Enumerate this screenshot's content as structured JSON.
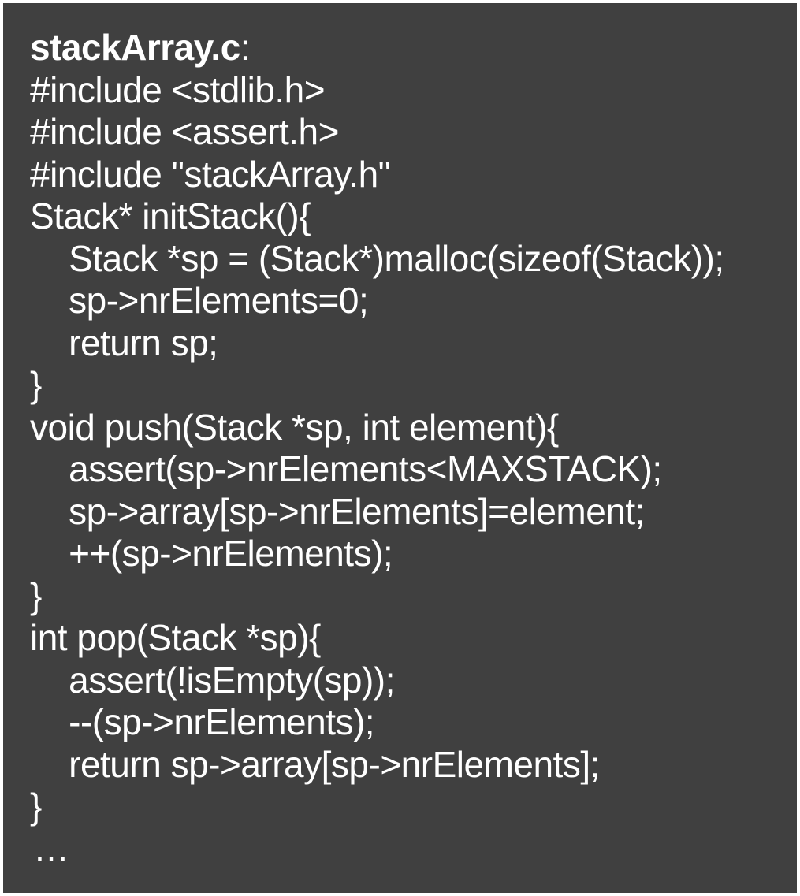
{
  "code": {
    "title": "stackArray.c",
    "title_suffix": ":",
    "lines": [
      "#include <stdlib.h>",
      "#include <assert.h>",
      "#include \"stackArray.h\"",
      "Stack* initStack(){",
      "    Stack *sp = (Stack*)malloc(sizeof(Stack));",
      "    sp->nrElements=0;",
      "    return sp;",
      "}",
      "void push(Stack *sp, int element){",
      "    assert(sp->nrElements<MAXSTACK);",
      "    sp->array[sp->nrElements]=element;",
      "    ++(sp->nrElements);",
      "}",
      "int pop(Stack *sp){",
      "    assert(!isEmpty(sp));",
      "    --(sp->nrElements);",
      "    return sp->array[sp->nrElements];",
      "}"
    ],
    "ellipsis": "…"
  }
}
